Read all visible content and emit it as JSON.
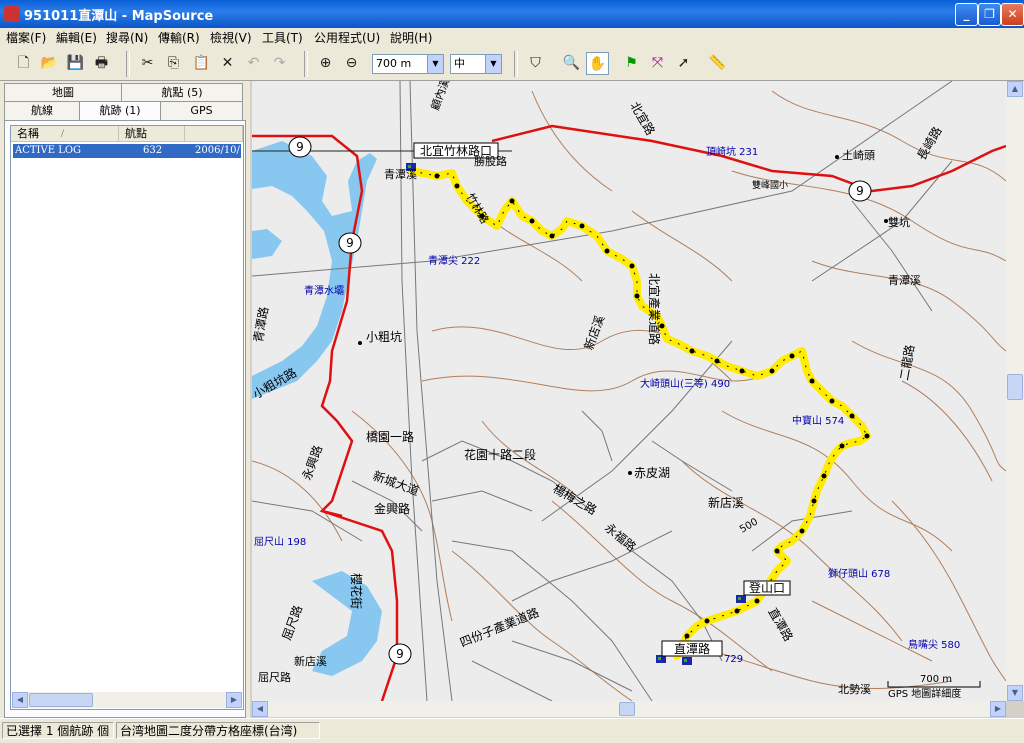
{
  "window": {
    "title": "951011直潭山 - MapSource"
  },
  "menu": [
    "檔案(F)",
    "編輯(E)",
    "搜尋(N)",
    "傳輸(R)",
    "檢視(V)",
    "工具(T)",
    "公用程式(U)",
    "說明(H)"
  ],
  "toolbar": {
    "zoom_value": "700 m",
    "detail_value": "中"
  },
  "left_panel": {
    "tabs_top": [
      "地圖",
      "航點 (5)"
    ],
    "tabs_bottom": [
      "航線",
      "航跡 (1)",
      "GPS"
    ],
    "columns": [
      "名稱",
      "航點"
    ],
    "tracks": [
      {
        "name": "ACTIVE LOG",
        "points": "632",
        "date": "2006/10/"
      }
    ]
  },
  "map": {
    "labels": {
      "l1": "北宜竹林路口",
      "l2": "青潭溪",
      "l3": "竹林路",
      "l4": "勝股路",
      "l5": "青潭尖 222",
      "l6": "青潭水壩",
      "l7": "小粗坑",
      "l8": "小粗坑路",
      "l9": "青潭路",
      "l10": "橋園一路",
      "l11": "花園十路二段",
      "l12": "新城大道",
      "l13": "金興路",
      "l14": "永興路",
      "l15": "赤皮湖",
      "l16": "楊梅之路",
      "l17": "永福路",
      "l18": "新店溪",
      "l19": "北宜產業道路",
      "l20": "大崎頭山(三等) 490",
      "l21": "中寶山 574",
      "l22": "登山口",
      "l23": "直潭路",
      "l24": "四份子產業道路",
      "l25": "獅仔頭山 678",
      "l26": "土崎頭",
      "l27": "雙坑",
      "l28": "北勢溪",
      "l29": "屈尺山 198",
      "l30": "屈尺路",
      "l31": "新店溪",
      "l32": "顧內溪",
      "l33": "頂崎坑 231",
      "l34": "雙峰國小",
      "l35": "鳥嘴尖 580",
      "l36": "500",
      "l37": "長崎路",
      "l38": "青潭溪",
      "l39": "櫻花街",
      "l40": "北宜路",
      "l41": "二龍路",
      "l42": "直潭路",
      "l43": "729",
      "l44": "新店溪",
      "l45": "屈尺路"
    },
    "road_shields": [
      "9",
      "9",
      "9",
      "9"
    ],
    "scale_text": "700 m",
    "scale_caption": "GPS 地圖詳細度"
  },
  "status": {
    "left": "已選擇 1 個航跡 個",
    "right": "台湾地圖二度分帶方格座標(台湾)"
  }
}
